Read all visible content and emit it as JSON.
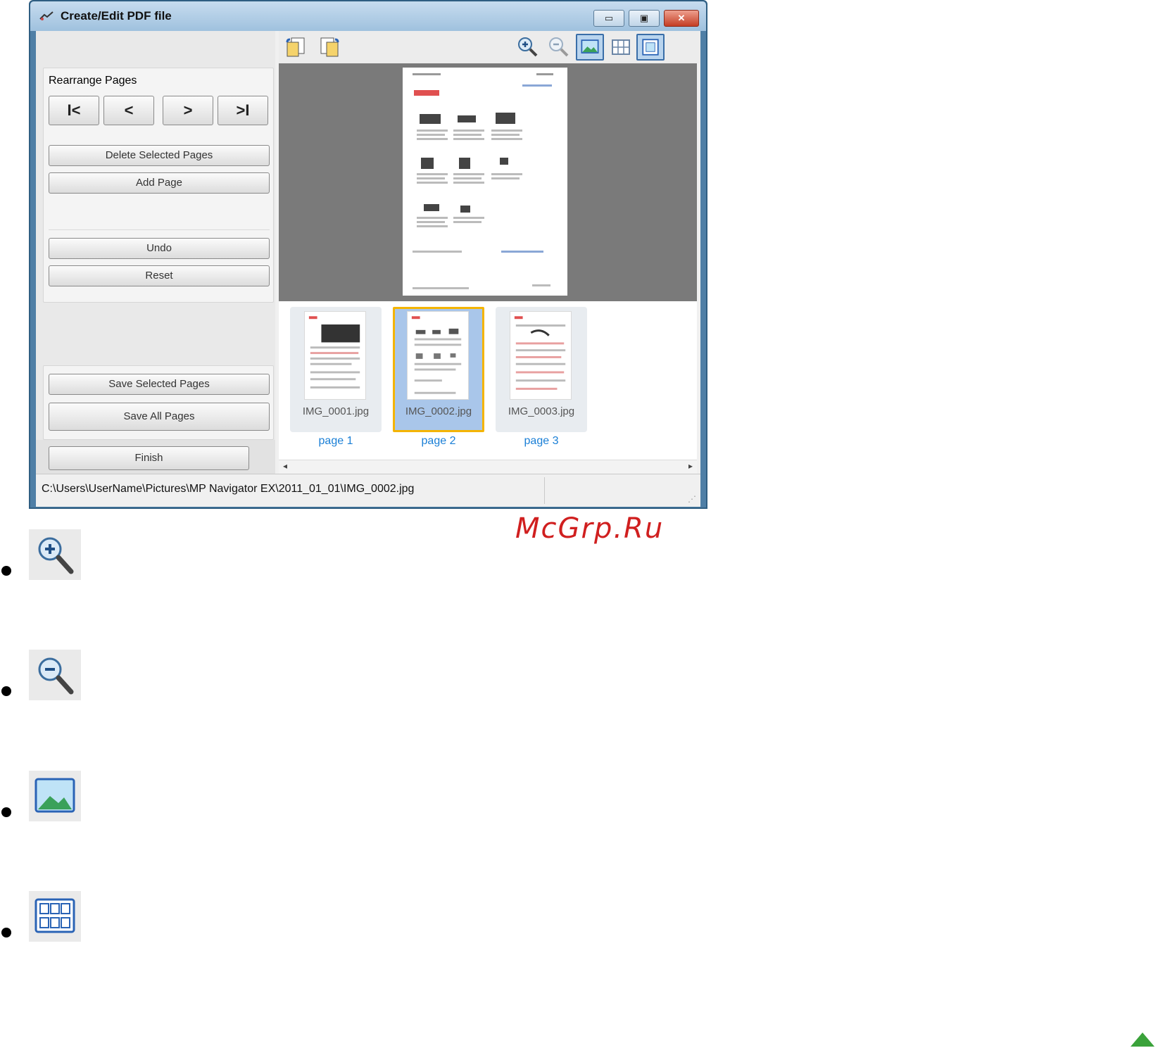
{
  "window": {
    "title": "Create/Edit PDF file",
    "min_symbol": "▭",
    "max_symbol": "▣",
    "close_symbol": "✕"
  },
  "left_pane": {
    "rearrange_label": "Rearrange Pages",
    "nav": {
      "first": "I<",
      "prev": "<",
      "next": ">",
      "last": ">I"
    },
    "delete_selected": "Delete Selected Pages",
    "add_page": "Add Page",
    "undo": "Undo",
    "reset": "Reset",
    "save_selected": "Save Selected Pages",
    "save_all": "Save All Pages",
    "finish": "Finish"
  },
  "toolbar": {
    "icons": [
      "rotate-left-icon",
      "rotate-right-icon",
      "zoom-in-icon",
      "zoom-out-icon",
      "preview-view-icon",
      "thumbnail-grid-icon",
      "fit-page-icon"
    ]
  },
  "thumbnails": [
    {
      "name": "IMG_0001.jpg",
      "page": "page 1",
      "selected": false
    },
    {
      "name": "IMG_0002.jpg",
      "page": "page 2",
      "selected": true
    },
    {
      "name": "IMG_0003.jpg",
      "page": "page 3",
      "selected": false
    }
  ],
  "statusbar": {
    "path": "C:\\Users\\UserName\\Pictures\\MP Navigator EX\\2011_01_01\\IMG_0002.jpg"
  },
  "watermark": "McGrp.Ru",
  "icon_list": [
    "zoom-in-icon",
    "zoom-out-icon",
    "preview-view-icon",
    "thumbnail-grid-icon"
  ],
  "colors": {
    "selection_border": "#f4b400",
    "page_link": "#1a7fd6",
    "watermark": "#d01f1f",
    "top_arrow": "#3aa23a"
  }
}
